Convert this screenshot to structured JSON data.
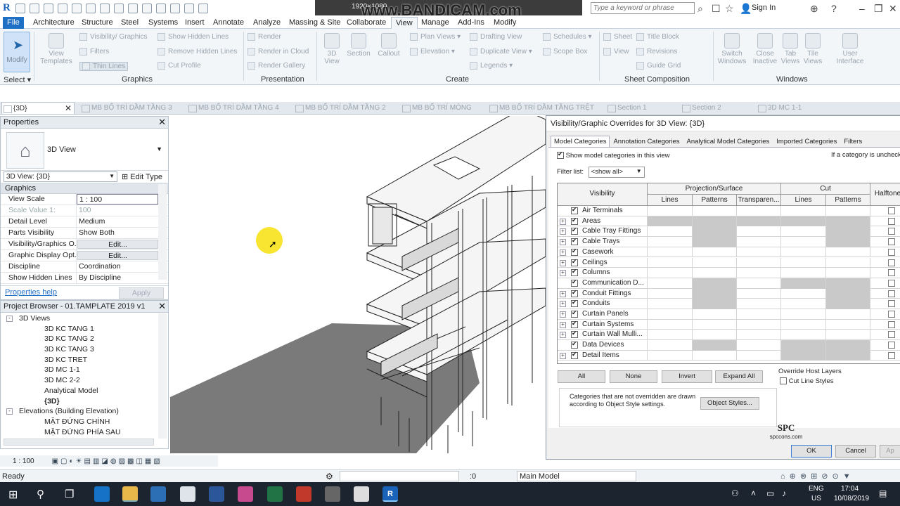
{
  "titlebar": {
    "watermark": "www.BANDICAM.com",
    "resolution": "1920×1080",
    "search_placeholder": "Type a keyword or phrase",
    "signin": "Sign In"
  },
  "menu": [
    "File",
    "Architecture",
    "Structure",
    "Steel",
    "Systems",
    "Insert",
    "Annotate",
    "Analyze",
    "Massing & Site",
    "Collaborate",
    "View",
    "Manage",
    "Add-Ins",
    "Modify"
  ],
  "ribbon": {
    "modify": "Modify",
    "select": "Select",
    "graphics": {
      "title": "Graphics",
      "view_templates": "View Templates",
      "vis_graphics": "Visibility/ Graphics",
      "filters": "Filters",
      "thin_lines": "Thin Lines",
      "show_hidden": "Show Hidden Lines",
      "remove_hidden": "Remove Hidden Lines",
      "cut_profile": "Cut Profile"
    },
    "presentation": {
      "title": "Presentation",
      "render": "Render",
      "render_cloud": "Render in Cloud",
      "render_gallery": "Render Gallery"
    },
    "create": {
      "title": "Create",
      "view3d": "3D View",
      "section": "Section",
      "callout": "Callout",
      "plan_views": "Plan Views",
      "elevation": "Elevation",
      "drafting": "Drafting View",
      "duplicate": "Duplicate View",
      "legends": "Legends",
      "schedules": "Schedules",
      "scope_box": "Scope Box"
    },
    "sheet": {
      "title": "Sheet Composition",
      "sheet": "Sheet",
      "view": "View",
      "title_block": "Title Block",
      "revisions": "Revisions",
      "guide_grid": "Guide Grid"
    },
    "windows": {
      "title": "Windows",
      "switch": "Switch Windows",
      "close": "Close Inactive",
      "tab": "Tab Views",
      "tile": "Tile Views",
      "ui": "User Interface"
    }
  },
  "view_tabs": [
    "{3D}",
    "MB BỐ TRÍ DẦM TẦNG 3",
    "MB BỐ TRÍ DẦM TẦNG 4",
    "MB BỐ TRÍ DẦM TẦNG 2",
    "MB BỐ TRÍ MÓNG",
    "MB BỐ TRÍ DẦM TẦNG TRỆT",
    "Section 1",
    "Section 2",
    "3D MC 1-1"
  ],
  "properties": {
    "title": "Properties",
    "type_name": "3D View",
    "selector": "3D View: {3D}",
    "edit_type": "Edit Type",
    "group": "Graphics",
    "rows": [
      {
        "k": "View Scale",
        "v": "1 : 100"
      },
      {
        "k": "Scale Value    1:",
        "v": "100"
      },
      {
        "k": "Detail Level",
        "v": "Medium"
      },
      {
        "k": "Parts Visibility",
        "v": "Show Both"
      },
      {
        "k": "Visibility/Graphics O...",
        "v": "Edit..."
      },
      {
        "k": "Graphic Display Opt...",
        "v": "Edit..."
      },
      {
        "k": "Discipline",
        "v": "Coordination"
      },
      {
        "k": "Show Hidden Lines",
        "v": "By Discipline"
      }
    ],
    "help": "Properties help",
    "apply": "Apply"
  },
  "browser": {
    "title": "Project Browser - 01.TAMPLATE 2019 v1",
    "items": [
      {
        "label": "3D Views",
        "level": 1,
        "exp": "-"
      },
      {
        "label": "3D KC TANG 1",
        "level": 2
      },
      {
        "label": "3D KC TANG 2",
        "level": 2
      },
      {
        "label": "3D KC TANG 3",
        "level": 2
      },
      {
        "label": "3D KC TRET",
        "level": 2
      },
      {
        "label": "3D MC 1-1",
        "level": 2
      },
      {
        "label": "3D MC 2-2",
        "level": 2
      },
      {
        "label": "Analytical Model",
        "level": 2
      },
      {
        "label": "{3D}",
        "level": 2,
        "bold": true
      },
      {
        "label": "Elevations (Building Elevation)",
        "level": 1,
        "exp": "-"
      },
      {
        "label": "MẶT ĐỨNG CHÍNH",
        "level": 2
      },
      {
        "label": "MẶT ĐỨNG PHÍA SAU",
        "level": 2
      }
    ]
  },
  "scale_bar": "1 : 100",
  "status": {
    "ready": "Ready",
    "zero": ":0",
    "model": "Main Model"
  },
  "dialog": {
    "title": "Visibility/Graphic Overrides for 3D View: {3D}",
    "tabs": [
      "Model Categories",
      "Annotation Categories",
      "Analytical Model Categories",
      "Imported Categories",
      "Filters"
    ],
    "show_model": "Show model categories in this view",
    "unchecked_note": "If a category is unchecked",
    "filter_label": "Filter list:",
    "filter_value": "<show all>",
    "headers": {
      "visibility": "Visibility",
      "projection": "Projection/Surface",
      "cut": "Cut",
      "lines": "Lines",
      "patterns": "Patterns",
      "transparency": "Transparen...",
      "halftone": "Halftone"
    },
    "rows": [
      {
        "name": "Air Terminals",
        "exp": false,
        "hatch": []
      },
      {
        "name": "Areas",
        "exp": true,
        "hatch": [
          0,
          1,
          2,
          3,
          4
        ]
      },
      {
        "name": "Cable Tray Fittings",
        "exp": true,
        "hatch": [
          1,
          4
        ]
      },
      {
        "name": "Cable Trays",
        "exp": true,
        "hatch": [
          1,
          4
        ]
      },
      {
        "name": "Casework",
        "exp": true,
        "hatch": []
      },
      {
        "name": "Ceilings",
        "exp": true,
        "hatch": []
      },
      {
        "name": "Columns",
        "exp": true,
        "hatch": []
      },
      {
        "name": "Communication D...",
        "exp": false,
        "hatch": [
          1,
          3,
          4
        ]
      },
      {
        "name": "Conduit Fittings",
        "exp": true,
        "hatch": [
          1,
          4
        ]
      },
      {
        "name": "Conduits",
        "exp": true,
        "hatch": [
          1,
          4
        ]
      },
      {
        "name": "Curtain Panels",
        "exp": true,
        "hatch": []
      },
      {
        "name": "Curtain Systems",
        "exp": true,
        "hatch": []
      },
      {
        "name": "Curtain Wall Mulli...",
        "exp": true,
        "hatch": []
      },
      {
        "name": "Data Devices",
        "exp": false,
        "hatch": [
          1,
          3,
          4
        ]
      },
      {
        "name": "Detail Items",
        "exp": true,
        "hatch": [
          3,
          4
        ]
      }
    ],
    "buttons": {
      "all": "All",
      "none": "None",
      "invert": "Invert",
      "expand": "Expand All",
      "object_styles": "Object Styles...",
      "ok": "OK",
      "cancel": "Cancel",
      "apply": "Ap"
    },
    "override_host": "Override Host Layers",
    "cut_line_styles": "Cut Line Styles",
    "note": "Categories that are not overridden are drawn according to Object Style settings."
  },
  "logo": {
    "text": "SPC",
    "site": "spccons.com"
  },
  "taskbar": {
    "lang": "ENG",
    "region": "US",
    "time": "17:04",
    "date": "10/08/2019"
  }
}
